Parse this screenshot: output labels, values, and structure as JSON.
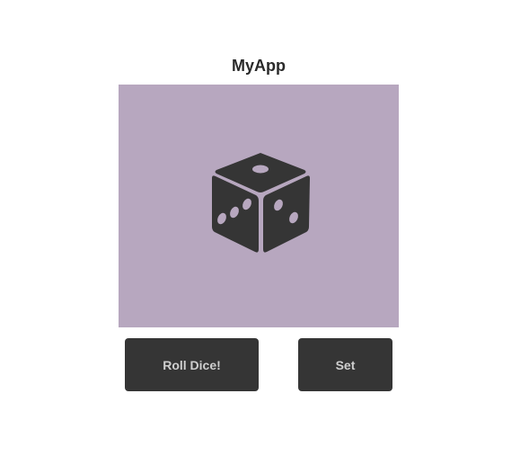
{
  "app": {
    "title": "MyApp"
  },
  "dice": {
    "icon": "dice-icon",
    "panel_color": "#b7a7bf",
    "die_color": "#353535"
  },
  "actions": {
    "roll_label": "Roll Dice!",
    "set_label": "Set"
  }
}
